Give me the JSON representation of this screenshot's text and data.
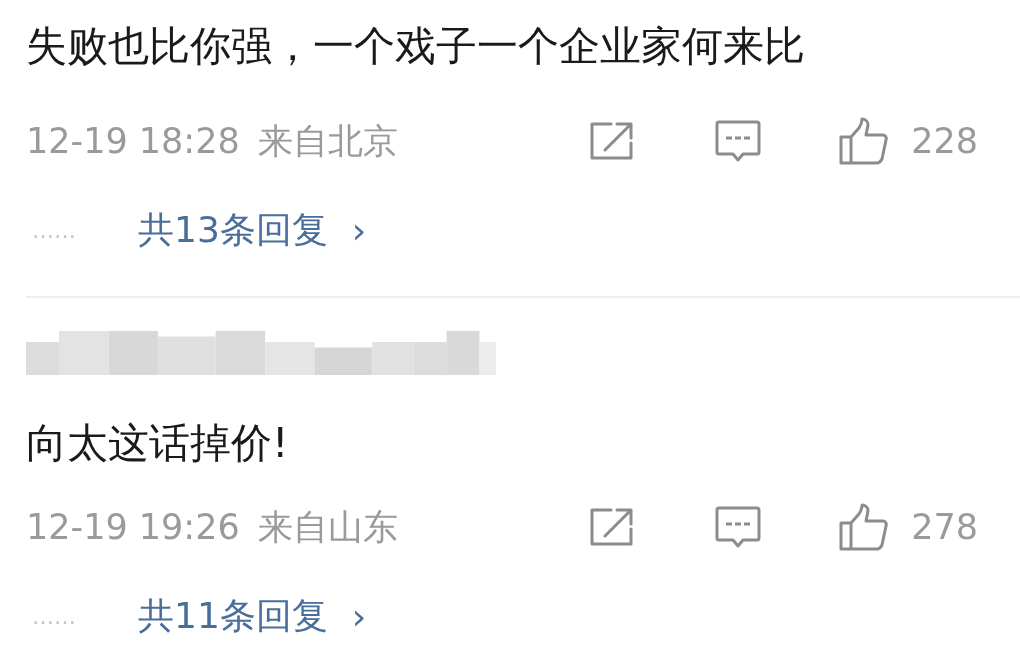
{
  "comments": [
    {
      "author_redacted": false,
      "text": "失败也比你强，一个戏子一个企业家何来比",
      "time": "12-19 18:28",
      "location": "来自北京",
      "likes": "228",
      "replies_prefix": "……",
      "replies": "共13条回复",
      "replies_arrow": "›"
    },
    {
      "author_redacted": true,
      "text": "向太这话掉价!",
      "time": "12-19 19:26",
      "location": "来自山东",
      "likes": "278",
      "replies_prefix": "……",
      "replies": "共11条回复",
      "replies_arrow": "›"
    }
  ]
}
